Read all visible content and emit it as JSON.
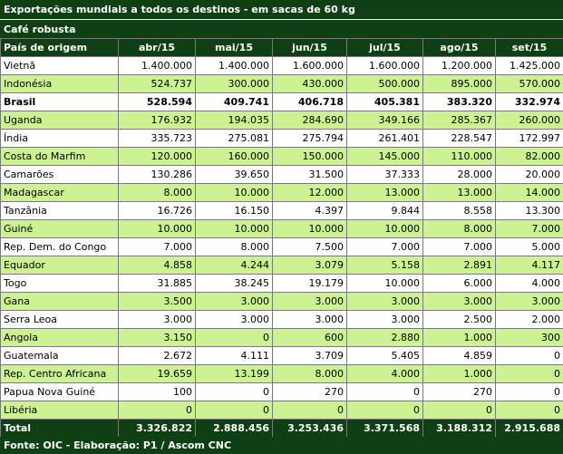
{
  "title": "Exportações mundiais a todos os destinos - em sacas de 60 kg",
  "subtitle": "Café robusta",
  "columns": [
    "País de origem",
    "abr/15",
    "mai/15",
    "jun/15",
    "jul/15",
    "ago/15",
    "set/15"
  ],
  "rows": [
    [
      "Vietnã",
      "1.400.000",
      "1.400.000",
      "1.600.000",
      "1.600.000",
      "1.200.000",
      "1.425.000"
    ],
    [
      "Indonésia",
      "524.737",
      "300.000",
      "430.000",
      "500.000",
      "895.000",
      "570.000"
    ],
    [
      "Brasil",
      "528.594",
      "409.741",
      "406.718",
      "405.381",
      "383.320",
      "332.974"
    ],
    [
      "Uganda",
      "176.932",
      "194.035",
      "284.690",
      "349.166",
      "285.367",
      "260.000"
    ],
    [
      "Índia",
      "335.723",
      "275.081",
      "275.794",
      "261.401",
      "228.547",
      "172.997"
    ],
    [
      "Costa do Marfim",
      "120.000",
      "160.000",
      "150.000",
      "145.000",
      "110.000",
      "82.000"
    ],
    [
      "Camarões",
      "130.286",
      "39.650",
      "31.500",
      "37.333",
      "28.000",
      "20.000"
    ],
    [
      "Madagascar",
      "8.000",
      "10.000",
      "12.000",
      "13.000",
      "13.000",
      "14.000"
    ],
    [
      "Tanzânia",
      "16.726",
      "16.150",
      "4.397",
      "9.844",
      "8.558",
      "13.300"
    ],
    [
      "Guiné",
      "10.000",
      "10.000",
      "10.000",
      "10.000",
      "8.000",
      "7.000"
    ],
    [
      "Rep. Dem. do Congo",
      "7.000",
      "8.000",
      "7.500",
      "7.000",
      "7.000",
      "5.000"
    ],
    [
      "Equador",
      "4.858",
      "4.244",
      "3.079",
      "5.158",
      "2.891",
      "4.117"
    ],
    [
      "Togo",
      "31.885",
      "38.245",
      "19.179",
      "10.000",
      "6.000",
      "4.000"
    ],
    [
      "Gana",
      "3.500",
      "3.000",
      "3.000",
      "3.000",
      "3.000",
      "3.000"
    ],
    [
      "Serra Leoa",
      "3.000",
      "3.000",
      "3.000",
      "3.000",
      "2.500",
      "2.000"
    ],
    [
      "Angola",
      "3.150",
      "0",
      "600",
      "2.880",
      "1.000",
      "300"
    ],
    [
      "Guatemala",
      "2.672",
      "4.111",
      "3.709",
      "5.405",
      "4.859",
      "0"
    ],
    [
      "Rep. Centro Africana",
      "19.659",
      "13.199",
      "8.000",
      "4.000",
      "1.000",
      "0"
    ],
    [
      "Papua Nova Guiné",
      "100",
      "0",
      "270",
      "0",
      "270",
      "0"
    ],
    [
      "Libéria",
      "0",
      "0",
      "0",
      "0",
      "0",
      "0"
    ]
  ],
  "total": [
    "Total",
    "3.326.822",
    "2.888.456",
    "3.253.436",
    "3.371.568",
    "3.188.312",
    "2.915.688"
  ],
  "footer": "Fonte: OIC - Elaboração: P1 / Ascom CNC"
}
